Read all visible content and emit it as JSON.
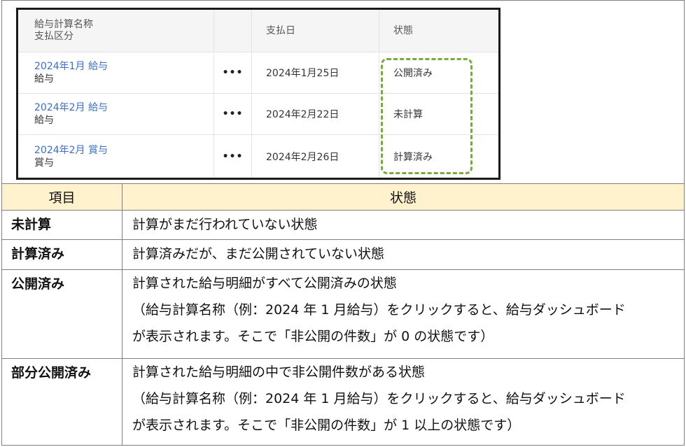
{
  "screenshot": {
    "header": {
      "col1_line1": "給与計算名称",
      "col1_line2": "支払区分",
      "col3": "支払日",
      "col4": "状態"
    },
    "rows": [
      {
        "name": "2024年1月 給与",
        "type": "給与",
        "more": "•••",
        "date": "2024年1月25日",
        "status": "公開済み"
      },
      {
        "name": "2024年2月 給与",
        "type": "給与",
        "more": "•••",
        "date": "2024年2月22日",
        "status": "未計算"
      },
      {
        "name": "2024年2月 賞与",
        "type": "賞与",
        "more": "•••",
        "date": "2024年2月26日",
        "status": "計算済み"
      }
    ],
    "highlight_color": "#77ab3a"
  },
  "table": {
    "header": {
      "item": "項目",
      "state": "状態"
    },
    "header_bg": "#fff2cc",
    "rows": [
      {
        "key": "未計算",
        "lines": [
          "計算がまだ行われていない状態"
        ]
      },
      {
        "key": "計算済み",
        "lines": [
          "計算済みだが、まだ公開されていない状態"
        ]
      },
      {
        "key": "公開済み",
        "lines": [
          "計算された給与明細がすべて公開済みの状態",
          "（給与計算名称（例：2024 年 1 月給与）をクリックすると、給与ダッシュボード",
          "が表示されます。そこで「非公開の件数」が 0 の状態です）"
        ]
      },
      {
        "key": "部分公開済み",
        "lines": [
          "計算された給与明細の中で非公開件数がある状態",
          "（給与計算名称（例：2024 年 1 月給与）をクリックすると、給与ダッシュボード",
          "が表示されます。そこで「非公開の件数」が 1 以上の状態です）"
        ]
      }
    ]
  }
}
